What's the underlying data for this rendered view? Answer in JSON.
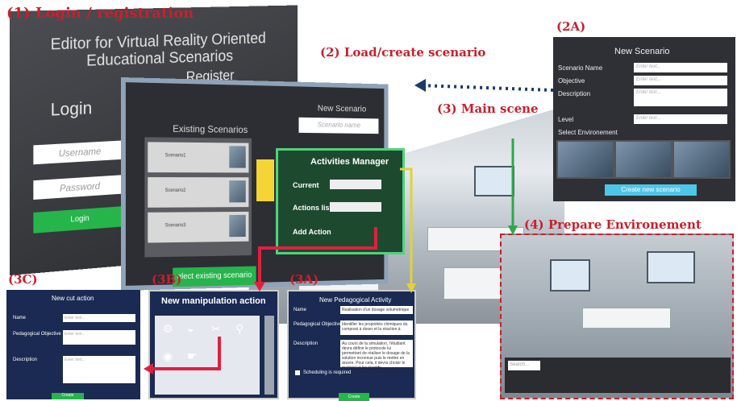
{
  "captions": {
    "c1": "(1) Login / registration",
    "c2": "(2) Load/create scenario",
    "c3": "(3) Main scene",
    "c2a": "(2A)",
    "c3a": "(3A)",
    "c3b": "(3B)",
    "c3c": "(3C)",
    "c4": "(4) Prepare Environement"
  },
  "p1": {
    "title": "Editor for Virtual Reality Oriented Educational Scenarios",
    "login": "Login",
    "register": "Register",
    "username": "Username",
    "password": "Password",
    "login_btn": "Login"
  },
  "p2": {
    "existing": "Existing Scenarios",
    "new_scenario": "New Scenario",
    "scenario_name": "Scenario name",
    "items": [
      "Scenario1",
      "Scenario2",
      "Scenario3"
    ],
    "select": "elect existing scenario"
  },
  "am": {
    "title": "Activities Manager",
    "current": "Current",
    "list": "Actions list",
    "add": "Add Action"
  },
  "p2a": {
    "title": "New Scenario",
    "name": "Scenario Name",
    "objective": "Objective",
    "description": "Description",
    "level": "Level",
    "select_env": "Select Environement",
    "placeholder": "Enter text...",
    "btn": "Create new scenario"
  },
  "p3a": {
    "title": "New Pedagogical Activity",
    "name": "Name",
    "name_val": "Realisation d'un dosage volumetrique",
    "obj": "Pedagogical Objective",
    "obj_val": "Identifier les propriétés chimiques du composé à doser et la réaction à",
    "desc": "Description",
    "desc_val": "Au cours de la simulation, l'étudiant devra définir le protocole lui permettant de réaliser le dosage de la solution inconnue puis le mettre en œuvre. Pour cela, il devra choisir le matériel et les réactifs",
    "sched": "Scheduling is required",
    "btn": "Create"
  },
  "p3b": {
    "title": "New manipulation action"
  },
  "p3c": {
    "title": "New cut action",
    "name": "Name",
    "obj": "Pedagogical Objective",
    "desc": "Description",
    "placeholder": "Enter text...",
    "btn": "Create"
  },
  "p4": {
    "search": "Search..."
  }
}
